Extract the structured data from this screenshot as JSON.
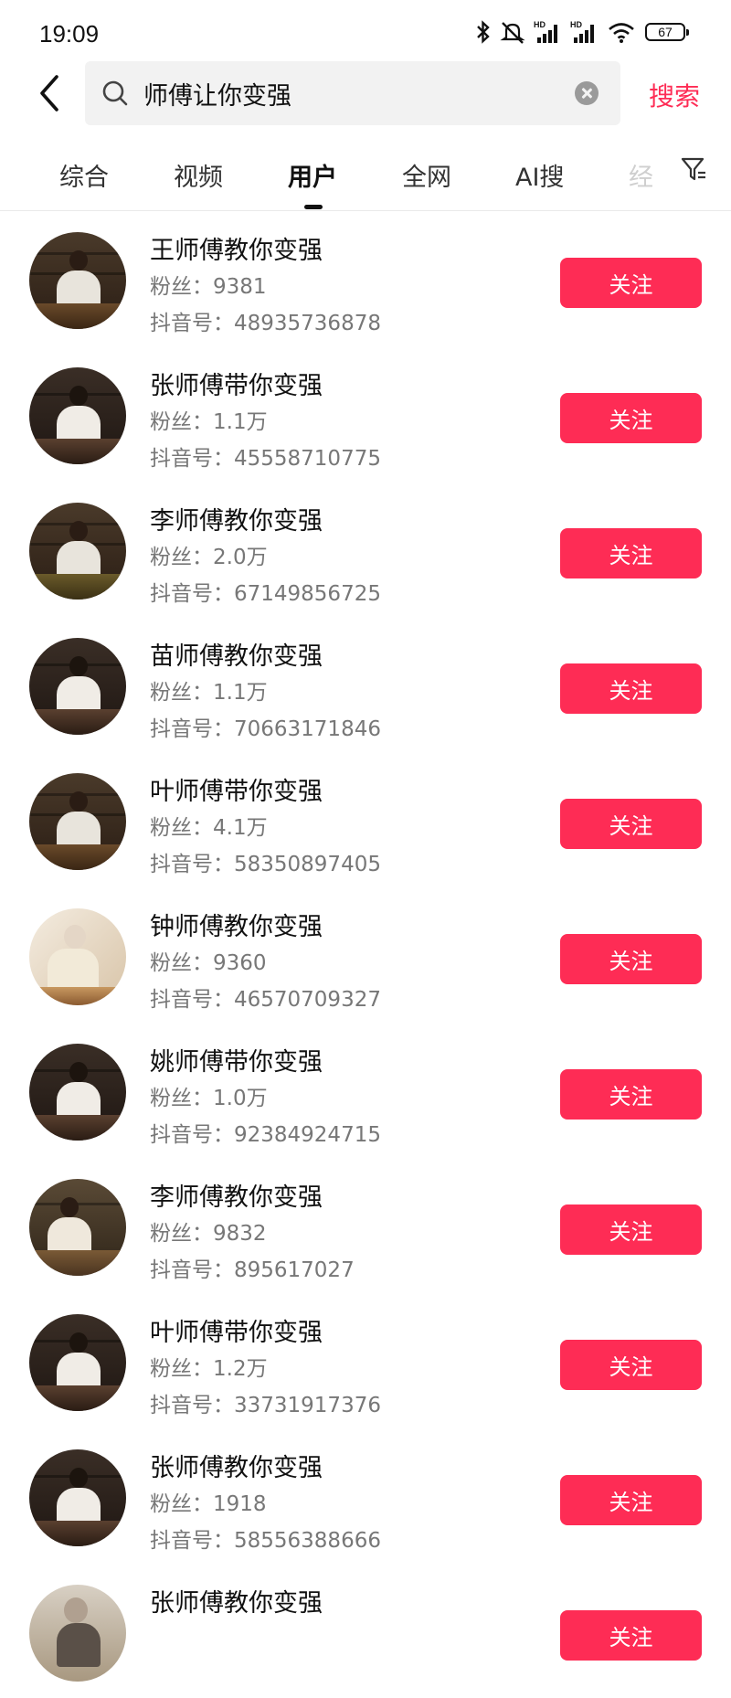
{
  "status": {
    "time": "19:09",
    "battery": "67"
  },
  "search": {
    "query": "师傅让你变强",
    "search_label": "搜索"
  },
  "tabs": [
    {
      "label": "综合"
    },
    {
      "label": "视频"
    },
    {
      "label": "用户"
    },
    {
      "label": "全网"
    },
    {
      "label": "AI搜"
    },
    {
      "label": "经"
    }
  ],
  "users": [
    {
      "name": "王师傅教你变强",
      "fans": "粉丝：9381",
      "douyin_id": "抖音号：48935736878",
      "follow": "关注"
    },
    {
      "name": "张师傅带你变强",
      "fans": "粉丝：1.1万",
      "douyin_id": "抖音号：45558710775",
      "follow": "关注"
    },
    {
      "name": "李师傅教你变强",
      "fans": "粉丝：2.0万",
      "douyin_id": "抖音号：67149856725",
      "follow": "关注"
    },
    {
      "name": "苗师傅教你变强",
      "fans": "粉丝：1.1万",
      "douyin_id": "抖音号：70663171846",
      "follow": "关注"
    },
    {
      "name": "叶师傅带你变强",
      "fans": "粉丝：4.1万",
      "douyin_id": "抖音号：58350897405",
      "follow": "关注"
    },
    {
      "name": "钟师傅教你变强",
      "fans": "粉丝：9360",
      "douyin_id": "抖音号：46570709327",
      "follow": "关注"
    },
    {
      "name": "姚师傅带你变强",
      "fans": "粉丝：1.0万",
      "douyin_id": "抖音号：92384924715",
      "follow": "关注"
    },
    {
      "name": "李师傅教你变强",
      "fans": "粉丝：9832",
      "douyin_id": "抖音号：895617027",
      "follow": "关注"
    },
    {
      "name": "叶师傅带你变强",
      "fans": "粉丝：1.2万",
      "douyin_id": "抖音号：33731917376",
      "follow": "关注"
    },
    {
      "name": "张师傅教你变强",
      "fans": "粉丝：1918",
      "douyin_id": "抖音号：58556388666",
      "follow": "关注"
    },
    {
      "name": "张师傅教你变强",
      "fans": "",
      "douyin_id": "",
      "follow": "关注"
    }
  ],
  "colors": {
    "accent": "#fe2c55"
  }
}
